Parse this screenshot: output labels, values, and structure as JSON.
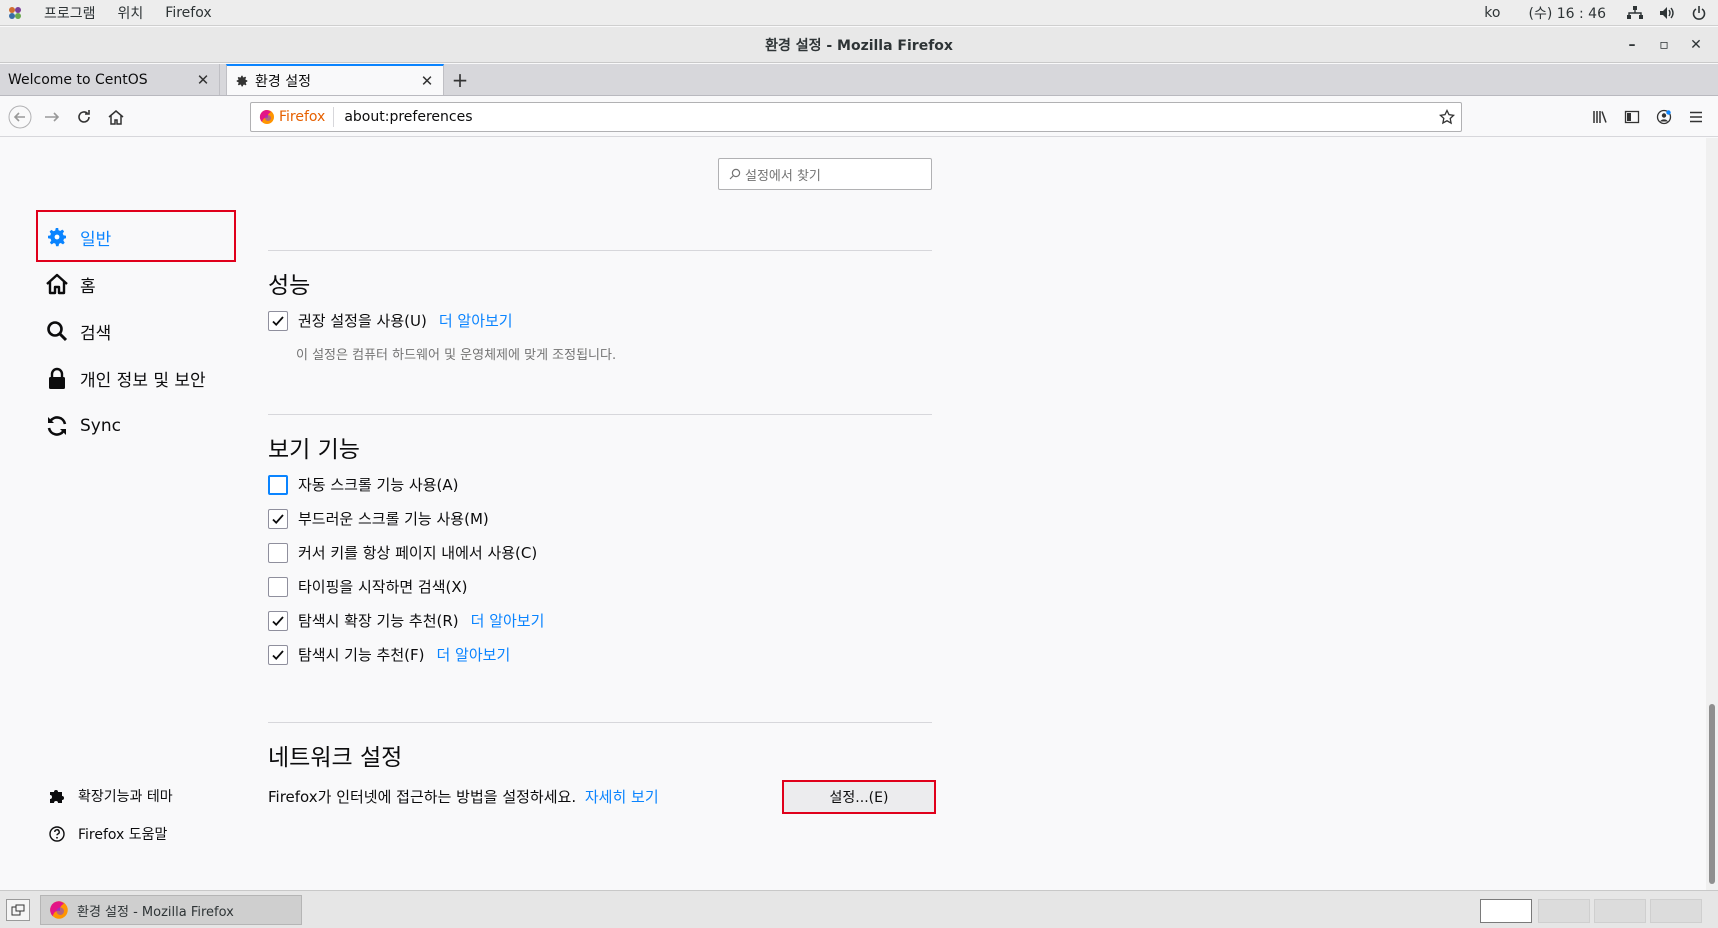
{
  "topbar": {
    "menu": [
      "프로그램",
      "위치",
      "Firefox"
    ],
    "lang": "ko",
    "clock": "(수) 16 : 46"
  },
  "window": {
    "title": "환경 설정 - Mozilla Firefox",
    "minimize": "–",
    "maximize": "▫",
    "close": "✕"
  },
  "tabs": [
    {
      "label": "Welcome to CentOS",
      "active": false
    },
    {
      "label": "환경 설정",
      "active": true
    }
  ],
  "navbar": {
    "identity_label": "Firefox",
    "url": "about:preferences"
  },
  "search": {
    "placeholder": "설정에서 찾기"
  },
  "sidebar": {
    "items": [
      {
        "label": "일반",
        "icon": "gear-icon",
        "selected": true
      },
      {
        "label": "홈",
        "icon": "home-icon"
      },
      {
        "label": "검색",
        "icon": "search-icon"
      },
      {
        "label": "개인 정보 및 보안",
        "icon": "lock-icon"
      },
      {
        "label": "Sync",
        "icon": "sync-icon"
      }
    ],
    "footer": [
      {
        "label": "확장기능과 테마",
        "icon": "puzzle-icon"
      },
      {
        "label": "Firefox 도움말",
        "icon": "help-icon"
      }
    ]
  },
  "performance": {
    "heading": "성능",
    "recommended": {
      "label": "권장 설정을 사용(U)",
      "checked": true,
      "link": "더 알아보기"
    },
    "description": "이 설정은 컴퓨터 하드웨어 및 운영체제에 맞게 조정됩니다."
  },
  "browsing": {
    "heading": "보기 기능",
    "options": [
      {
        "label": "자동 스크롤 기능 사용(A)",
        "checked": false
      },
      {
        "label": "부드러운 스크롤 기능 사용(M)",
        "checked": true
      },
      {
        "label": "커서 키를 항상 페이지 내에서 사용(C)",
        "checked": false
      },
      {
        "label": "타이핑을 시작하면 검색(X)",
        "checked": false
      },
      {
        "label": "탐색시 확장 기능 추천(R)",
        "checked": true,
        "link": "더 알아보기"
      },
      {
        "label": "탐색시 기능 추천(F)",
        "checked": true,
        "link": "더 알아보기"
      }
    ]
  },
  "network": {
    "heading": "네트워크 설정",
    "text": "Firefox가 인터넷에 접근하는 방법을 설정하세요.",
    "link": "자세히 보기",
    "button": "설정...(E)"
  },
  "taskbar": {
    "task_label": "환경 설정 - Mozilla Firefox"
  },
  "colors": {
    "accent": "#0a84ff",
    "highlight_box": "#e0001b"
  }
}
